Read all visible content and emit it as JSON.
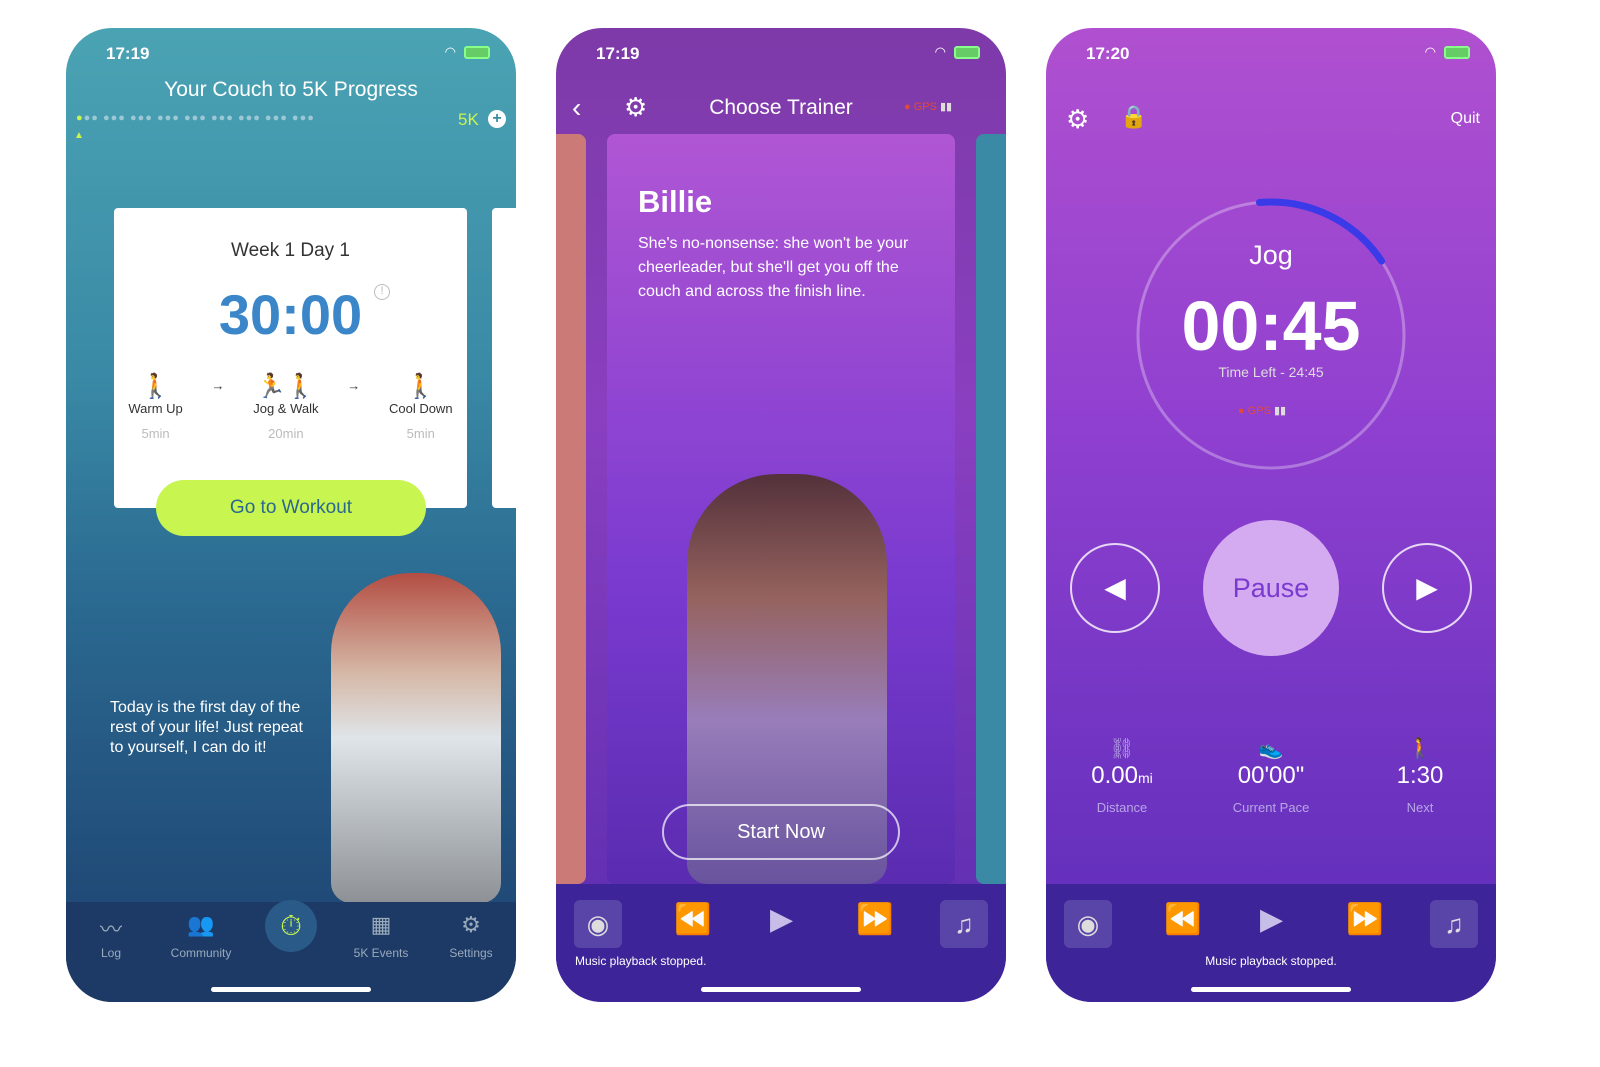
{
  "screen1": {
    "time": "17:19",
    "title": "Your Couch to 5K Progress",
    "goal": "5K",
    "card": {
      "title": "Week 1 Day 1",
      "duration": "30:00",
      "steps": [
        {
          "label": "Warm Up",
          "duration": "5min"
        },
        {
          "label": "Jog & Walk",
          "duration": "20min"
        },
        {
          "label": "Cool Down",
          "duration": "5min"
        }
      ],
      "button": "Go to Workout"
    },
    "quote": "Today is the first day of the rest of your life! Just repeat to yourself, I can do it!",
    "tabs": [
      {
        "label": "Log",
        "icon": "chart-line-icon"
      },
      {
        "label": "Community",
        "icon": "people-icon"
      },
      {
        "label": "",
        "icon": "stopwatch-icon"
      },
      {
        "label": "5K Events",
        "icon": "calendar-icon"
      },
      {
        "label": "Settings",
        "icon": "gear-icon"
      }
    ],
    "accent": "#c8f550",
    "timer_color": "#3a86c8"
  },
  "screen2": {
    "time": "17:19",
    "title": "Choose Trainer",
    "gps": "GPS",
    "trainer": {
      "name": "Billie",
      "description": "She's no-nonsense: she won't be your cheerleader, but she'll get you off the couch and across the finish line."
    },
    "button": "Start Now",
    "music_status": "Music playback stopped."
  },
  "screen3": {
    "time": "17:20",
    "quit": "Quit",
    "activity": "Jog",
    "time_left_big": "00:45",
    "time_left_label": "Time Left - 24:45",
    "gps": "GPS",
    "progress_fraction": 0.17,
    "pause": "Pause",
    "stats": [
      {
        "value": "0.00",
        "unit": "mi",
        "label": "Distance",
        "icon": "binoculars-icon"
      },
      {
        "value": "00'00\"",
        "unit": "",
        "label": "Current Pace",
        "icon": "shoe-icon"
      },
      {
        "value": "1:30",
        "unit": "",
        "label": "Next",
        "icon": "walking-icon"
      }
    ],
    "music_status": "Music playback stopped."
  }
}
